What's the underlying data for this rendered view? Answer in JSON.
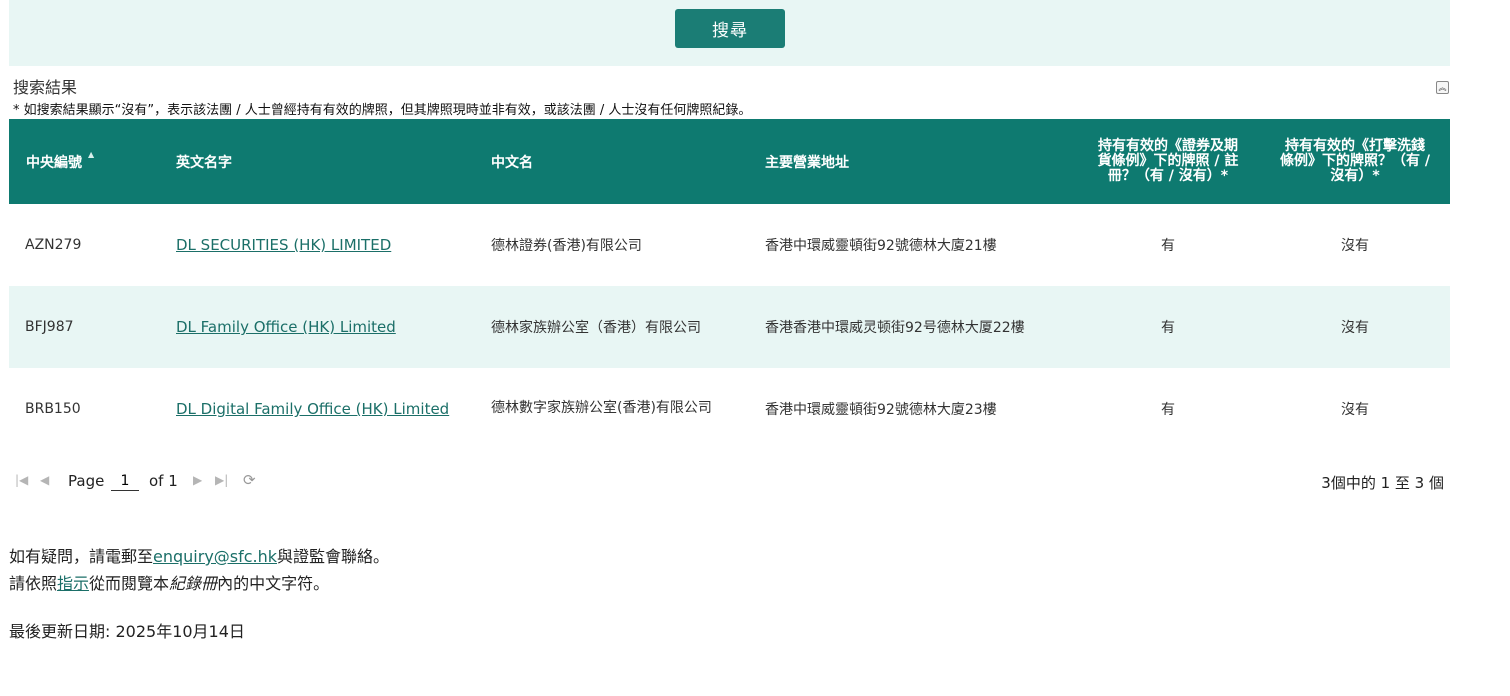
{
  "search": {
    "button_label": "搜尋"
  },
  "results": {
    "title": "搜索結果",
    "note": "* 如搜索結果顯示“沒有”，表示該法團 / 人士曾經持有有效的牌照，但其牌照現時並非有效，或該法團 / 人士沒有任何牌照紀錄。"
  },
  "table": {
    "headers": {
      "ce_no": "中央編號",
      "en_name": "英文名字",
      "zh_name": "中文名",
      "address": "主要營業地址",
      "sfo": "持有有效的《證券及期貨條例》下的牌照 / 註冊？（有 / 沒有）*",
      "amlo": "持有有效的《打擊洗錢條例》下的牌照？（有 / 沒有）*"
    },
    "rows": [
      {
        "ce_no": "AZN279",
        "en_name": "DL SECURITIES (HK) LIMITED",
        "zh_name": "德林證券(香港)有限公司",
        "address": "香港中環威靈頓街92號德林大廈21樓",
        "sfo": "有",
        "amlo": "沒有"
      },
      {
        "ce_no": "BFJ987",
        "en_name": "DL Family Office (HK) Limited",
        "zh_name": "德林家族辦公室（香港）有限公司",
        "address": "香港香港中環威灵顿街92号德林大厦22樓",
        "sfo": "有",
        "amlo": "沒有"
      },
      {
        "ce_no": "BRB150",
        "en_name": "DL Digital Family Office (HK) Limited",
        "zh_name": "德林數字家族辦公室(香港)有限公司",
        "address": "香港中環威靈頓街92號德林大廈23樓",
        "sfo": "有",
        "amlo": "沒有"
      }
    ]
  },
  "pager": {
    "page_label": "Page",
    "page_value": "1",
    "of_label": "of 1",
    "count_text": "3個中的 1 至 3 個"
  },
  "footer": {
    "contact_prefix": "如有疑問，請電郵至",
    "contact_email": "enquiry@sfc.hk",
    "contact_suffix": "與證監會聯絡。",
    "guide_prefix": "請依照",
    "guide_link": "指示",
    "guide_middle": "從而閱覽本",
    "guide_italic": "紀錄冊",
    "guide_suffix": "內的中文字符。",
    "updated": "最後更新日期: 2025年10月14日"
  }
}
